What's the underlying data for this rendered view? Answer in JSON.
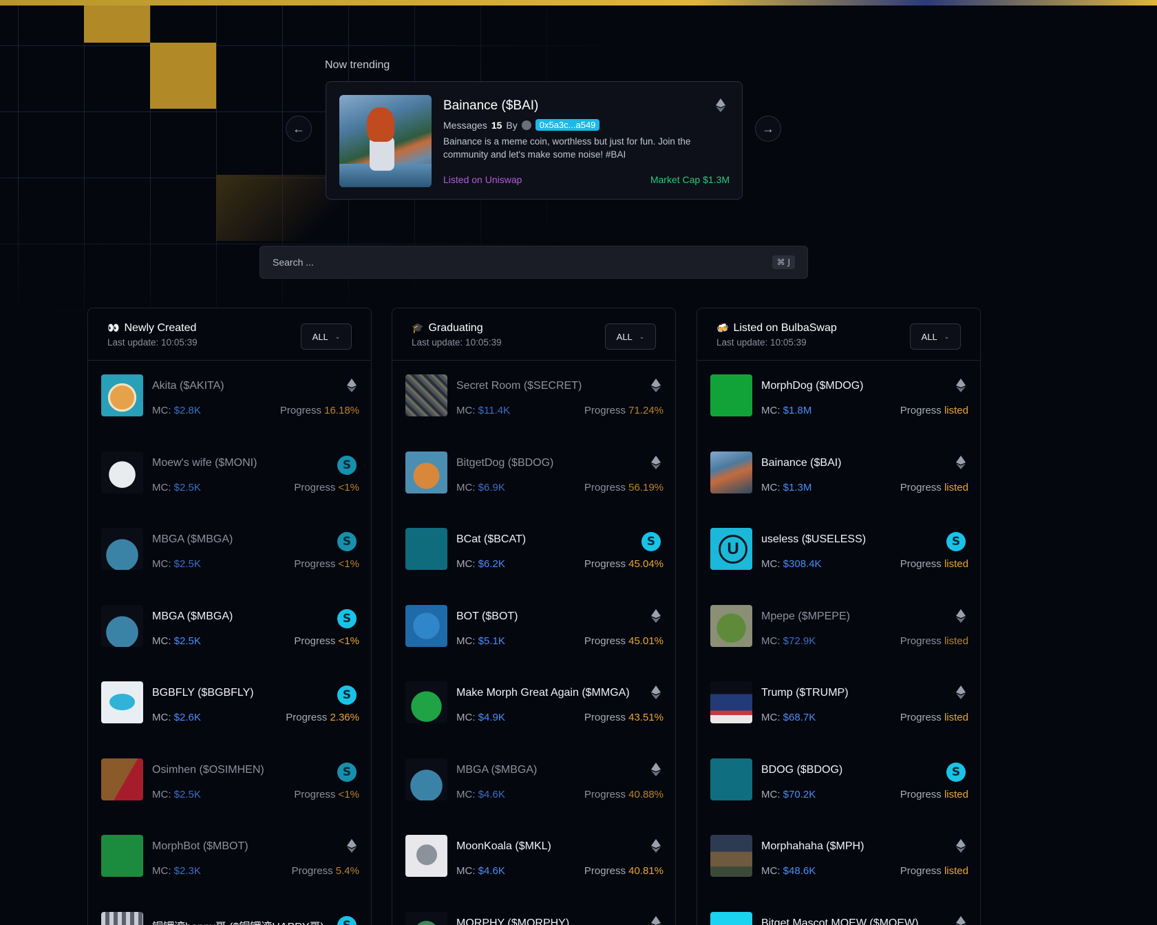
{
  "trending": {
    "label": "Now trending",
    "title": "Bainance ($BAI)",
    "messages_label": "Messages",
    "messages_count": "15",
    "by_label": "By",
    "address": "0x5a3c...a549",
    "description": "Bainance is a meme coin, worthless but just for fun. Join the community and let's make some noise! #BAI",
    "listed": "Listed on Uniswap",
    "market_cap": "Market Cap $1.3M",
    "chain_icon": "ethereum-icon"
  },
  "search": {
    "placeholder": "Search ...",
    "shortcut": "⌘ J"
  },
  "columns": [
    {
      "emoji": "👀",
      "title": "Newly Created",
      "update": "Last update: 10:05:39",
      "filter": "ALL",
      "items": [
        {
          "name": "Akita ($AKITA)",
          "mc_label": "MC:",
          "mc": "$2.8K",
          "progress_label": "Progress",
          "progress": "16.18%",
          "chain": "ethereum-icon"
        },
        {
          "name": "Moew's wife ($MONI)",
          "mc_label": "MC:",
          "mc": "$2.5K",
          "progress_label": "Progress",
          "progress": "<1%",
          "chain": "bulbaswap-icon"
        },
        {
          "name": "MBGA ($MBGA)",
          "mc_label": "MC:",
          "mc": "$2.5K",
          "progress_label": "Progress",
          "progress": "<1%",
          "chain": "bulbaswap-icon"
        },
        {
          "name": "MBGA ($MBGA)",
          "mc_label": "MC:",
          "mc": "$2.5K",
          "progress_label": "Progress",
          "progress": "<1%",
          "chain": "bulbaswap-icon"
        },
        {
          "name": "BGBFLY ($BGBFLY)",
          "mc_label": "MC:",
          "mc": "$2.6K",
          "progress_label": "Progress",
          "progress": "2.36%",
          "chain": "bulbaswap-icon"
        },
        {
          "name": "Osimhen ($OSIMHEN)",
          "mc_label": "MC:",
          "mc": "$2.5K",
          "progress_label": "Progress",
          "progress": "<1%",
          "chain": "bulbaswap-icon"
        },
        {
          "name": "MorphBot ($MBOT)",
          "mc_label": "MC:",
          "mc": "$2.3K",
          "progress_label": "Progress",
          "progress": "5.4%",
          "chain": "ethereum-icon"
        },
        {
          "name": "铜锣湾happy哥 ($铜锣湾HAPPY哥)",
          "mc_label": "",
          "mc": "",
          "progress_label": "",
          "progress": "",
          "chain": "bulbaswap-icon"
        }
      ]
    },
    {
      "emoji": "🎓",
      "title": "Graduating",
      "update": "Last update: 10:05:39",
      "filter": "ALL",
      "items": [
        {
          "name": "Secret Room ($SECRET)",
          "mc_label": "MC:",
          "mc": "$11.4K",
          "progress_label": "Progress",
          "progress": "71.24%",
          "chain": "ethereum-icon"
        },
        {
          "name": "BitgetDog ($BDOG)",
          "mc_label": "MC:",
          "mc": "$6.9K",
          "progress_label": "Progress",
          "progress": "56.19%",
          "chain": "ethereum-icon"
        },
        {
          "name": "BCat ($BCAT)",
          "mc_label": "MC:",
          "mc": "$6.2K",
          "progress_label": "Progress",
          "progress": "45.04%",
          "chain": "bulbaswap-icon"
        },
        {
          "name": "BOT ($BOT)",
          "mc_label": "MC:",
          "mc": "$5.1K",
          "progress_label": "Progress",
          "progress": "45.01%",
          "chain": "ethereum-icon"
        },
        {
          "name": "Make Morph Great Again ($MMGA)",
          "mc_label": "MC:",
          "mc": "$4.9K",
          "progress_label": "Progress",
          "progress": "43.51%",
          "chain": "ethereum-icon"
        },
        {
          "name": "MBGA ($MBGA)",
          "mc_label": "MC:",
          "mc": "$4.6K",
          "progress_label": "Progress",
          "progress": "40.88%",
          "chain": "ethereum-icon"
        },
        {
          "name": "MoonKoala ($MKL)",
          "mc_label": "MC:",
          "mc": "$4.6K",
          "progress_label": "Progress",
          "progress": "40.81%",
          "chain": "ethereum-icon"
        },
        {
          "name": "MORPHY ($MORPHY)",
          "mc_label": "",
          "mc": "",
          "progress_label": "",
          "progress": "",
          "chain": "ethereum-icon"
        }
      ]
    },
    {
      "emoji": "🍻",
      "title": "Listed on BulbaSwap",
      "update": "Last update: 10:05:39",
      "filter": "ALL",
      "items": [
        {
          "name": "MorphDog ($MDOG)",
          "mc_label": "MC:",
          "mc": "$1.8M",
          "progress_label": "Progress",
          "progress": "listed",
          "chain": "ethereum-icon"
        },
        {
          "name": "Bainance ($BAI)",
          "mc_label": "MC:",
          "mc": "$1.3M",
          "progress_label": "Progress",
          "progress": "listed",
          "chain": "ethereum-icon"
        },
        {
          "name": "useless ($USELESS)",
          "mc_label": "MC:",
          "mc": "$308.4K",
          "progress_label": "Progress",
          "progress": "listed",
          "chain": "bulbaswap-icon"
        },
        {
          "name": "Mpepe ($MPEPE)",
          "mc_label": "MC:",
          "mc": "$72.9K",
          "progress_label": "Progress",
          "progress": "listed",
          "chain": "ethereum-icon"
        },
        {
          "name": "Trump ($TRUMP)",
          "mc_label": "MC:",
          "mc": "$68.7K",
          "progress_label": "Progress",
          "progress": "listed",
          "chain": "ethereum-icon"
        },
        {
          "name": "BDOG ($BDOG)",
          "mc_label": "MC:",
          "mc": "$70.2K",
          "progress_label": "Progress",
          "progress": "listed",
          "chain": "bulbaswap-icon"
        },
        {
          "name": "Morphahaha ($MPH)",
          "mc_label": "MC:",
          "mc": "$48.6K",
          "progress_label": "Progress",
          "progress": "listed",
          "chain": "ethereum-icon"
        },
        {
          "name": "Bitget Mascot MOEW ($MOEW)",
          "mc_label": "",
          "mc": "",
          "progress_label": "",
          "progress": "",
          "chain": "ethereum-icon"
        }
      ]
    }
  ]
}
